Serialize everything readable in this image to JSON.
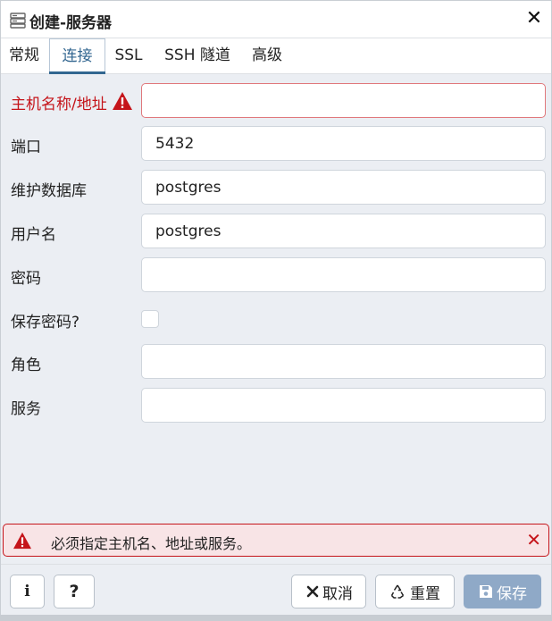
{
  "dialog": {
    "title": "创建-服务器",
    "icons": {
      "title": "server-icon",
      "close": "close-icon"
    }
  },
  "tabs": [
    {
      "label": "常规",
      "active": false
    },
    {
      "label": "连接",
      "active": true
    },
    {
      "label": "SSL",
      "active": false
    },
    {
      "label": "SSH 隧道",
      "active": false
    },
    {
      "label": "高级",
      "active": false
    }
  ],
  "form": {
    "host": {
      "label": "主机名称/地址",
      "value": "",
      "error": true
    },
    "port": {
      "label": "端口",
      "value": "5432"
    },
    "maintenance_db": {
      "label": "维护数据库",
      "value": "postgres"
    },
    "username": {
      "label": "用户名",
      "value": "postgres"
    },
    "password": {
      "label": "密码",
      "value": ""
    },
    "save_password": {
      "label": "保存密码?",
      "checked": false
    },
    "role": {
      "label": "角色",
      "value": ""
    },
    "service": {
      "label": "服务",
      "value": ""
    }
  },
  "error": {
    "message": "必须指定主机名、地址或服务。",
    "icon": "warning-icon",
    "close_icon": "close-icon"
  },
  "footer": {
    "info_label": "i",
    "help_label": "?",
    "cancel_label": "取消",
    "reset_label": "重置",
    "save_label": "保存"
  },
  "colors": {
    "accent": "#326690",
    "error": "#c5141a",
    "save_disabled": "#8fa9c7"
  }
}
